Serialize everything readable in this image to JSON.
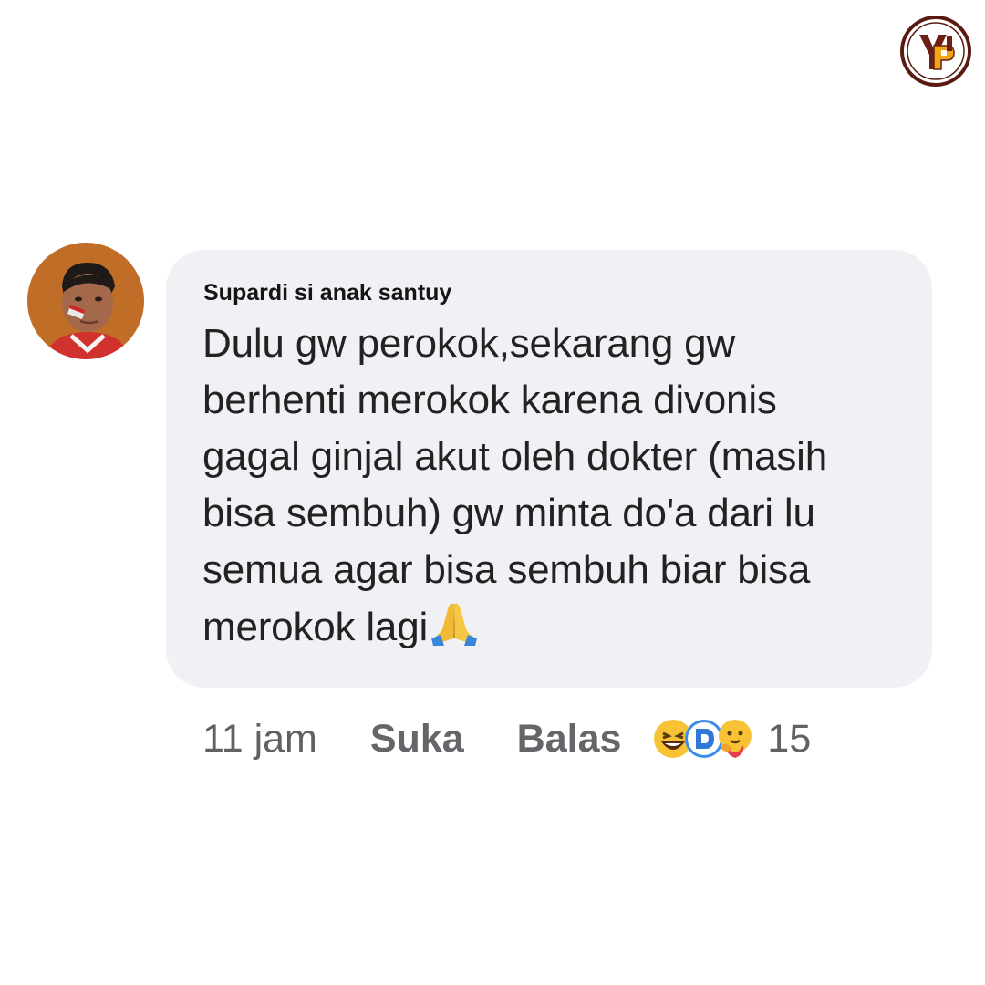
{
  "comment": {
    "author": "Supardi si anak santuy",
    "text_lines": [
      "Dulu gw perokok,sekarang gw",
      "berhenti merokok karena divonis",
      "gagal ginjal akut oleh dokter (masih",
      "bisa sembuh) gw minta do'a dari lu",
      "semua agar bisa sembuh biar bisa",
      "merokok lagi"
    ],
    "emoji_icon": "folded-hands-icon"
  },
  "actions": {
    "timestamp": "11 jam",
    "like_label": "Suka",
    "reply_label": "Balas",
    "reaction_icons": [
      "laughing-face-icon",
      "haha-reaction-icon",
      "care-hug-icon"
    ],
    "reaction_count": "15"
  },
  "watermark": {
    "logo_text": "YP",
    "logo_colors": {
      "ring": "#5a1a12",
      "accent": "#f2a516"
    }
  }
}
